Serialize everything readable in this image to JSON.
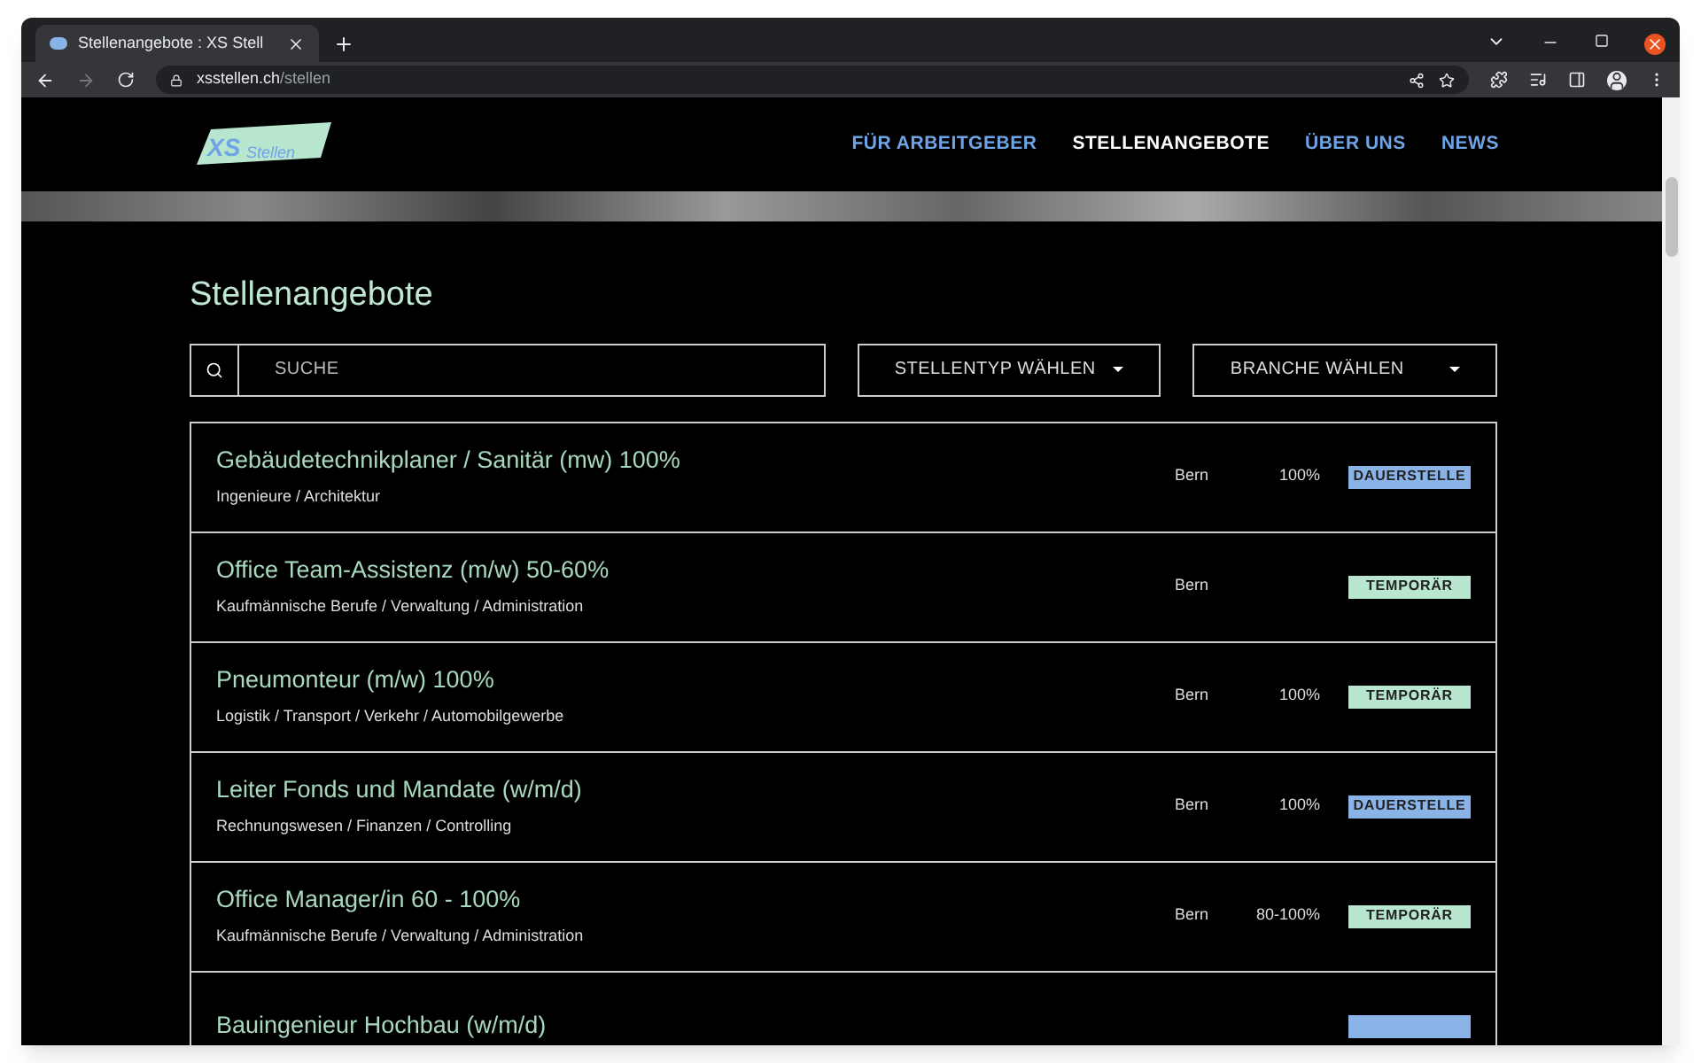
{
  "browser": {
    "tab_title": "Stellenangebote : XS Stell",
    "url_host": "xsstellen.ch",
    "url_path": "/stellen"
  },
  "nav": [
    {
      "label": "FÜR ARBEITGEBER",
      "selected": false
    },
    {
      "label": "STELLENANGEBOTE",
      "selected": true
    },
    {
      "label": "ÜBER UNS",
      "selected": false
    },
    {
      "label": "NEWS",
      "selected": false
    }
  ],
  "logo": {
    "mark": "XS",
    "name": "Stellen"
  },
  "heading": "Stellenangebote",
  "search": {
    "placeholder": "SUCHE"
  },
  "filters": [
    "STELLENTYP WÄHLEN",
    "BRANCHE WÄHLEN"
  ],
  "jobs": [
    {
      "title": "Gebäudetechnikplaner / Sanitär (mw) 100%",
      "category": "Ingenieure / Architektur",
      "location": "Bern",
      "workload": "100%",
      "type": {
        "kind": "permanent",
        "label": "DAUERSTELLE"
      }
    },
    {
      "title": "Office Team-Assistenz (m/w) 50-60%",
      "category": "Kaufmännische Berufe / Verwaltung / Administration",
      "location": "Bern",
      "type": {
        "kind": "temporary",
        "label": "TEMPORÄR"
      }
    },
    {
      "title": "Pneumonteur (m/w) 100%",
      "category": "Logistik / Transport / Verkehr / Automobilgewerbe",
      "location": "Bern",
      "workload": "100%",
      "type": {
        "kind": "temporary",
        "label": "TEMPORÄR"
      }
    },
    {
      "title": "Leiter Fonds und Mandate (w/m/d)",
      "category": "Rechnungswesen / Finanzen / Controlling",
      "location": "Bern",
      "workload": "100%",
      "type": {
        "kind": "permanent",
        "label": "DAUERSTELLE"
      }
    },
    {
      "title": "Office Manager/in 60 - 100%",
      "category": "Kaufmännische Berufe / Verwaltung / Administration",
      "location": "Bern",
      "workload": "80-100%",
      "type": {
        "kind": "temporary",
        "label": "TEMPORÄR"
      }
    },
    {
      "title": "Bauingenieur Hochbau (w/m/d)",
      "type": {
        "kind": "permanent"
      }
    }
  ]
}
